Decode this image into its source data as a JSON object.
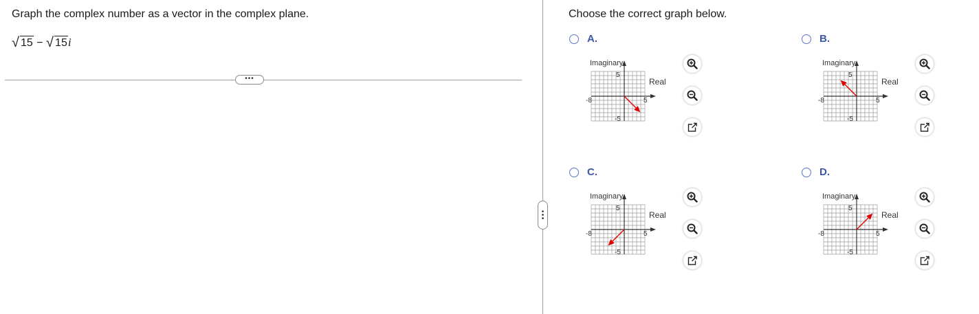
{
  "question": {
    "prompt": "Graph the complex number as a vector in the complex plane.",
    "expression": {
      "radicand_a": "15",
      "operator": "−",
      "radicand_b": "15",
      "unit": "i"
    }
  },
  "answer_area": {
    "title": "Choose the correct graph below.",
    "options": [
      {
        "key": "A.",
        "selected": false,
        "imag_label": "Imaginary",
        "real_label": "Real",
        "y_max": "5",
        "y_min": "-5",
        "x_min": "-8",
        "x_max": "5",
        "vector": {
          "from": [
            0,
            0
          ],
          "to": [
            3.9,
            -3.9
          ]
        }
      },
      {
        "key": "B.",
        "selected": false,
        "imag_label": "Imaginary",
        "real_label": "Real",
        "y_max": "5",
        "y_min": "-5",
        "x_min": "-8",
        "x_max": "5",
        "vector": {
          "from": [
            0,
            0
          ],
          "to": [
            -3.9,
            3.9
          ]
        }
      },
      {
        "key": "C.",
        "selected": false,
        "imag_label": "Imaginary",
        "real_label": "Real",
        "y_max": "5",
        "y_min": "-5",
        "x_min": "-8",
        "x_max": "5",
        "vector": {
          "from": [
            0,
            0
          ],
          "to": [
            -3.9,
            -3.9
          ]
        }
      },
      {
        "key": "D.",
        "selected": false,
        "imag_label": "Imaginary",
        "real_label": "Real",
        "y_max": "5",
        "y_min": "-5",
        "x_min": "-8",
        "x_max": "5",
        "vector": {
          "from": [
            0,
            0
          ],
          "to": [
            3.9,
            3.9
          ]
        }
      }
    ],
    "tools": [
      "zoom-in-icon",
      "zoom-out-icon",
      "open-in-new-window-icon"
    ]
  },
  "colors": {
    "vector": "#e00000",
    "accent": "#3a56a8",
    "radio": "#5b76c9",
    "grid": "#9a9a9a"
  },
  "controls": {
    "expand_dots": "•••"
  }
}
